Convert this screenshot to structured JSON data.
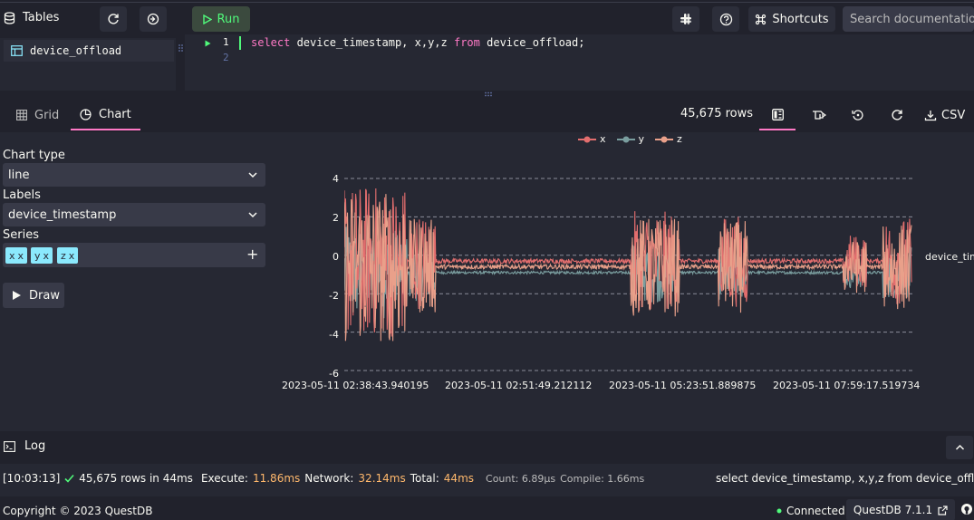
{
  "topbar": {
    "tables_label": "Tables",
    "run_label": "Run",
    "shortcuts_label": "Shortcuts",
    "search_placeholder": "Search documentation"
  },
  "tables": {
    "items": [
      {
        "label": "device_offload"
      }
    ]
  },
  "editor": {
    "line_numbers": [
      "1",
      "2"
    ],
    "code": {
      "kw1": "select",
      "part1": " device_timestamp, x,y,z ",
      "kw2": "from",
      "part2": " device_offload;"
    }
  },
  "tabs": {
    "grid": "Grid",
    "chart": "Chart",
    "row_count": "45,675 rows",
    "csv_label": "CSV"
  },
  "chart_config": {
    "chart_type_label": "Chart type",
    "chart_type_value": "line",
    "labels_label": "Labels",
    "labels_value": "device_timestamp",
    "series_label": "Series",
    "series_chips": [
      "x",
      "y",
      "z"
    ],
    "draw_label": "Draw"
  },
  "colors": {
    "x": "#e36e6e",
    "y": "#7a9e9f",
    "z": "#e9a08a",
    "accent": "#ff79c6",
    "run": "#50fa7b"
  },
  "chart_data": {
    "type": "line",
    "x_axis_name": "device_time",
    "yticks": [
      "4",
      "2",
      "0",
      "-2",
      "-4",
      "-6"
    ],
    "ylim": [
      -6,
      4
    ],
    "xticks": [
      "2023-05-11 02:38:43.940195",
      "2023-05-11 02:51:49.212112",
      "2023-05-11 05:23:51.889875",
      "2023-05-11 07:59:17.519734"
    ],
    "series": [
      {
        "name": "x",
        "baseline": -0.3,
        "color": "#e36e6e"
      },
      {
        "name": "y",
        "baseline": -0.9,
        "color": "#7a9e9f"
      },
      {
        "name": "z",
        "baseline": -0.6,
        "color": "#e9a08a"
      }
    ],
    "grid": true,
    "legend": "top-center"
  },
  "log": {
    "title": "Log",
    "time": "[10:03:13]",
    "rows": "45,675 rows in 44ms",
    "execute_label": "Execute:",
    "execute_value": "11.86ms",
    "network_label": "Network:",
    "network_value": "32.14ms",
    "total_label": "Total:",
    "total_value": "44ms",
    "count": "Count: 6.89μs",
    "compile": "Compile: 1.66ms",
    "query": "select device_timestamp, x,y,z from device_offload;"
  },
  "footer": {
    "copyright": "Copyright © 2023 QuestDB",
    "status": "Connected",
    "version": "QuestDB 7.1.1"
  }
}
